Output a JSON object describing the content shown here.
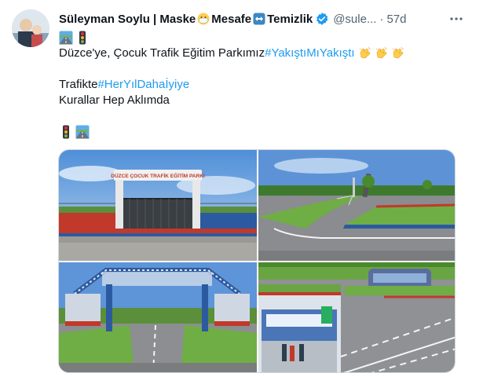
{
  "author": {
    "name_part1": "Süleyman Soylu | Maske",
    "name_part2": "Mesafe",
    "name_part3": "Temizlik",
    "handle": "@sule...",
    "separator": "·",
    "timestamp": "57d"
  },
  "tweet": {
    "line1_text": "Düzce'ye, Çocuk Trafik Eğitim Parkımız ",
    "line1_hashtag": "#YakıştıMıYakıştı",
    "line2_text": "Trafikte ",
    "line2_hashtag": "#HerYılDahaİyiye",
    "line3_text": "Kurallar Hep Aklımda"
  },
  "media": {
    "photo1_sign": "DÜZCE ÇOCUK TRAFİK EĞİTİM PARKI"
  },
  "icons": [
    "mask-emoji-icon",
    "left-right-arrow-emoji-icon",
    "verified-badge-icon",
    "more-options-icon",
    "motorway-emoji-icon",
    "traffic-light-icon",
    "clapping-hands-icon"
  ],
  "colors": {
    "accent": "#1d9bf0",
    "secondary_text": "#536471",
    "border": "#cfd9de"
  }
}
